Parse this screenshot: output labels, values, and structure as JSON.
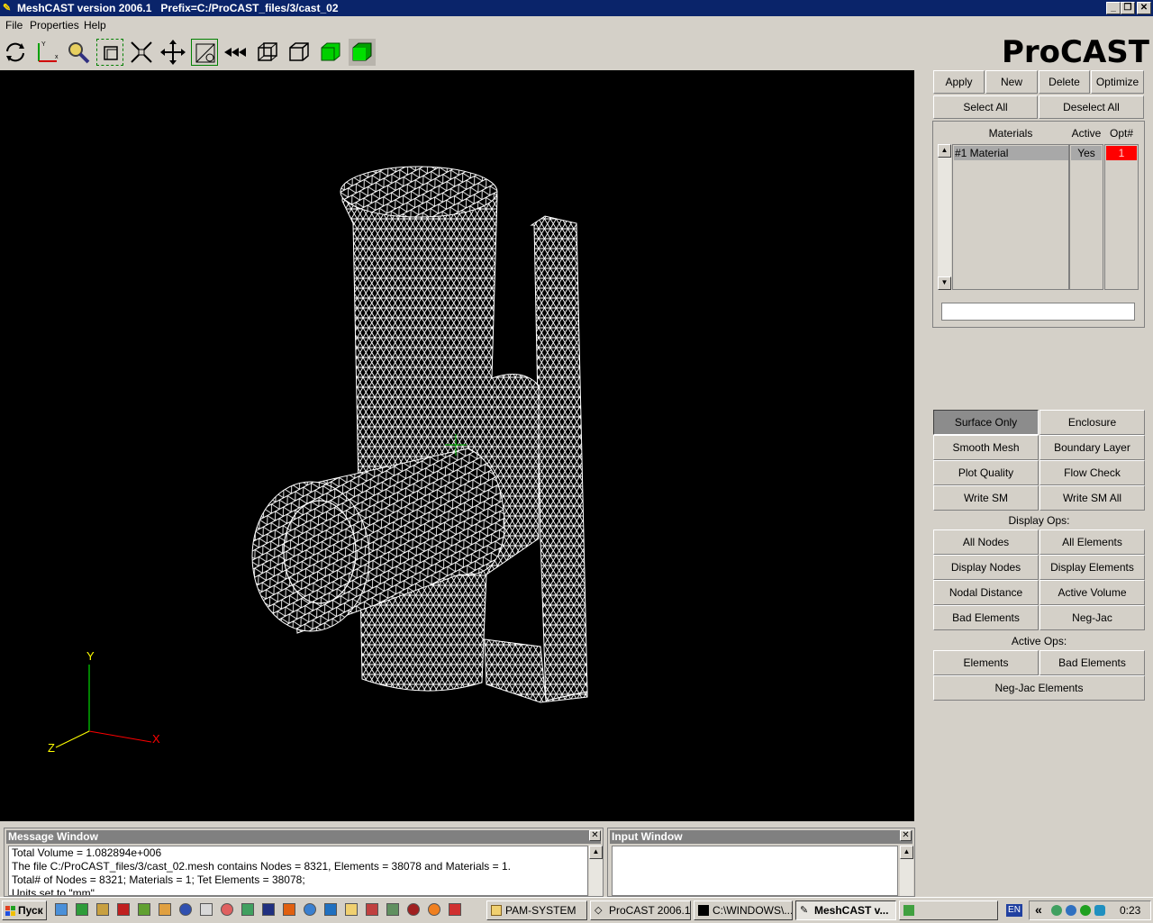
{
  "window": {
    "title": "MeshCAST version 2006.1   Prefix=C:/ProCAST_files/3/cast_02",
    "min_glyph": "_",
    "max_glyph": "❐",
    "close_glyph": "✕"
  },
  "menu": [
    "File",
    "Properties",
    "Help"
  ],
  "toolbar": {
    "icons": [
      "rotate-icon",
      "axes-icon",
      "zoom-icon",
      "zoom-box-icon",
      "fit-icon",
      "pan-icon",
      "select-icon",
      "rewind-icon",
      "wireframe-box-icon",
      "outline-box-icon",
      "green-solid-icon",
      "green-shaded-icon"
    ]
  },
  "logo": "ProCAST",
  "panel": {
    "actions": [
      "Apply",
      "New",
      "Delete",
      "Optimize"
    ],
    "select_all": "Select All",
    "deselect_all": "Deselect All",
    "headers": {
      "materials": "Materials",
      "active": "Active",
      "opt": "Opt#"
    },
    "materials": [
      {
        "name": "#1 Material",
        "active": "Yes",
        "opt": "1"
      }
    ],
    "input_value": "",
    "mesh_ops": [
      [
        "Surface Only",
        "Enclosure"
      ],
      [
        "Smooth Mesh",
        "Boundary Layer"
      ],
      [
        "Plot Quality",
        "Flow Check"
      ],
      [
        "Write SM",
        "Write SM All"
      ]
    ],
    "display_ops_label": "Display Ops:",
    "display_ops": [
      [
        "All Nodes",
        "All Elements"
      ],
      [
        "Display Nodes",
        "Display Elements"
      ],
      [
        "Nodal Distance",
        "Active Volume"
      ],
      [
        "Bad Elements",
        "Neg-Jac"
      ]
    ],
    "active_ops_label": "Active Ops:",
    "active_ops": [
      "Elements",
      "Bad Elements"
    ],
    "negjac_elements": "Neg-Jac Elements"
  },
  "axes": {
    "y": "Y",
    "x": "X",
    "z": "Z"
  },
  "message_window": {
    "title": "Message Window",
    "lines": [
      "Total Volume = 1.082894e+006",
      "The file C:/ProCAST_files/3/cast_02.mesh contains Nodes = 8321, Elements = 38078 and Materials = 1.",
      "Total# of Nodes = 8321; Materials = 1; Tet Elements = 38078;",
      "Units set to \"mm\""
    ]
  },
  "input_window": {
    "title": "Input Window"
  },
  "taskbar": {
    "start": "Пуск",
    "tasks": [
      {
        "label": "PAM-SYSTEM",
        "active": false
      },
      {
        "label": "ProCAST 2006.1",
        "active": false
      },
      {
        "label": "C:\\WINDOWS\\...",
        "active": false
      },
      {
        "label": "MeshCAST v...",
        "active": true
      }
    ],
    "lang": "EN",
    "tray_chevron": "«",
    "clock": "0:23"
  },
  "colors": {
    "title_bg": "#0a246a",
    "opt_cell": "#ff0000",
    "viewport_bg": "#000000",
    "axis_y": "#00ff00",
    "axis_x": "#ff0000",
    "axis_z": "#ffff00"
  }
}
